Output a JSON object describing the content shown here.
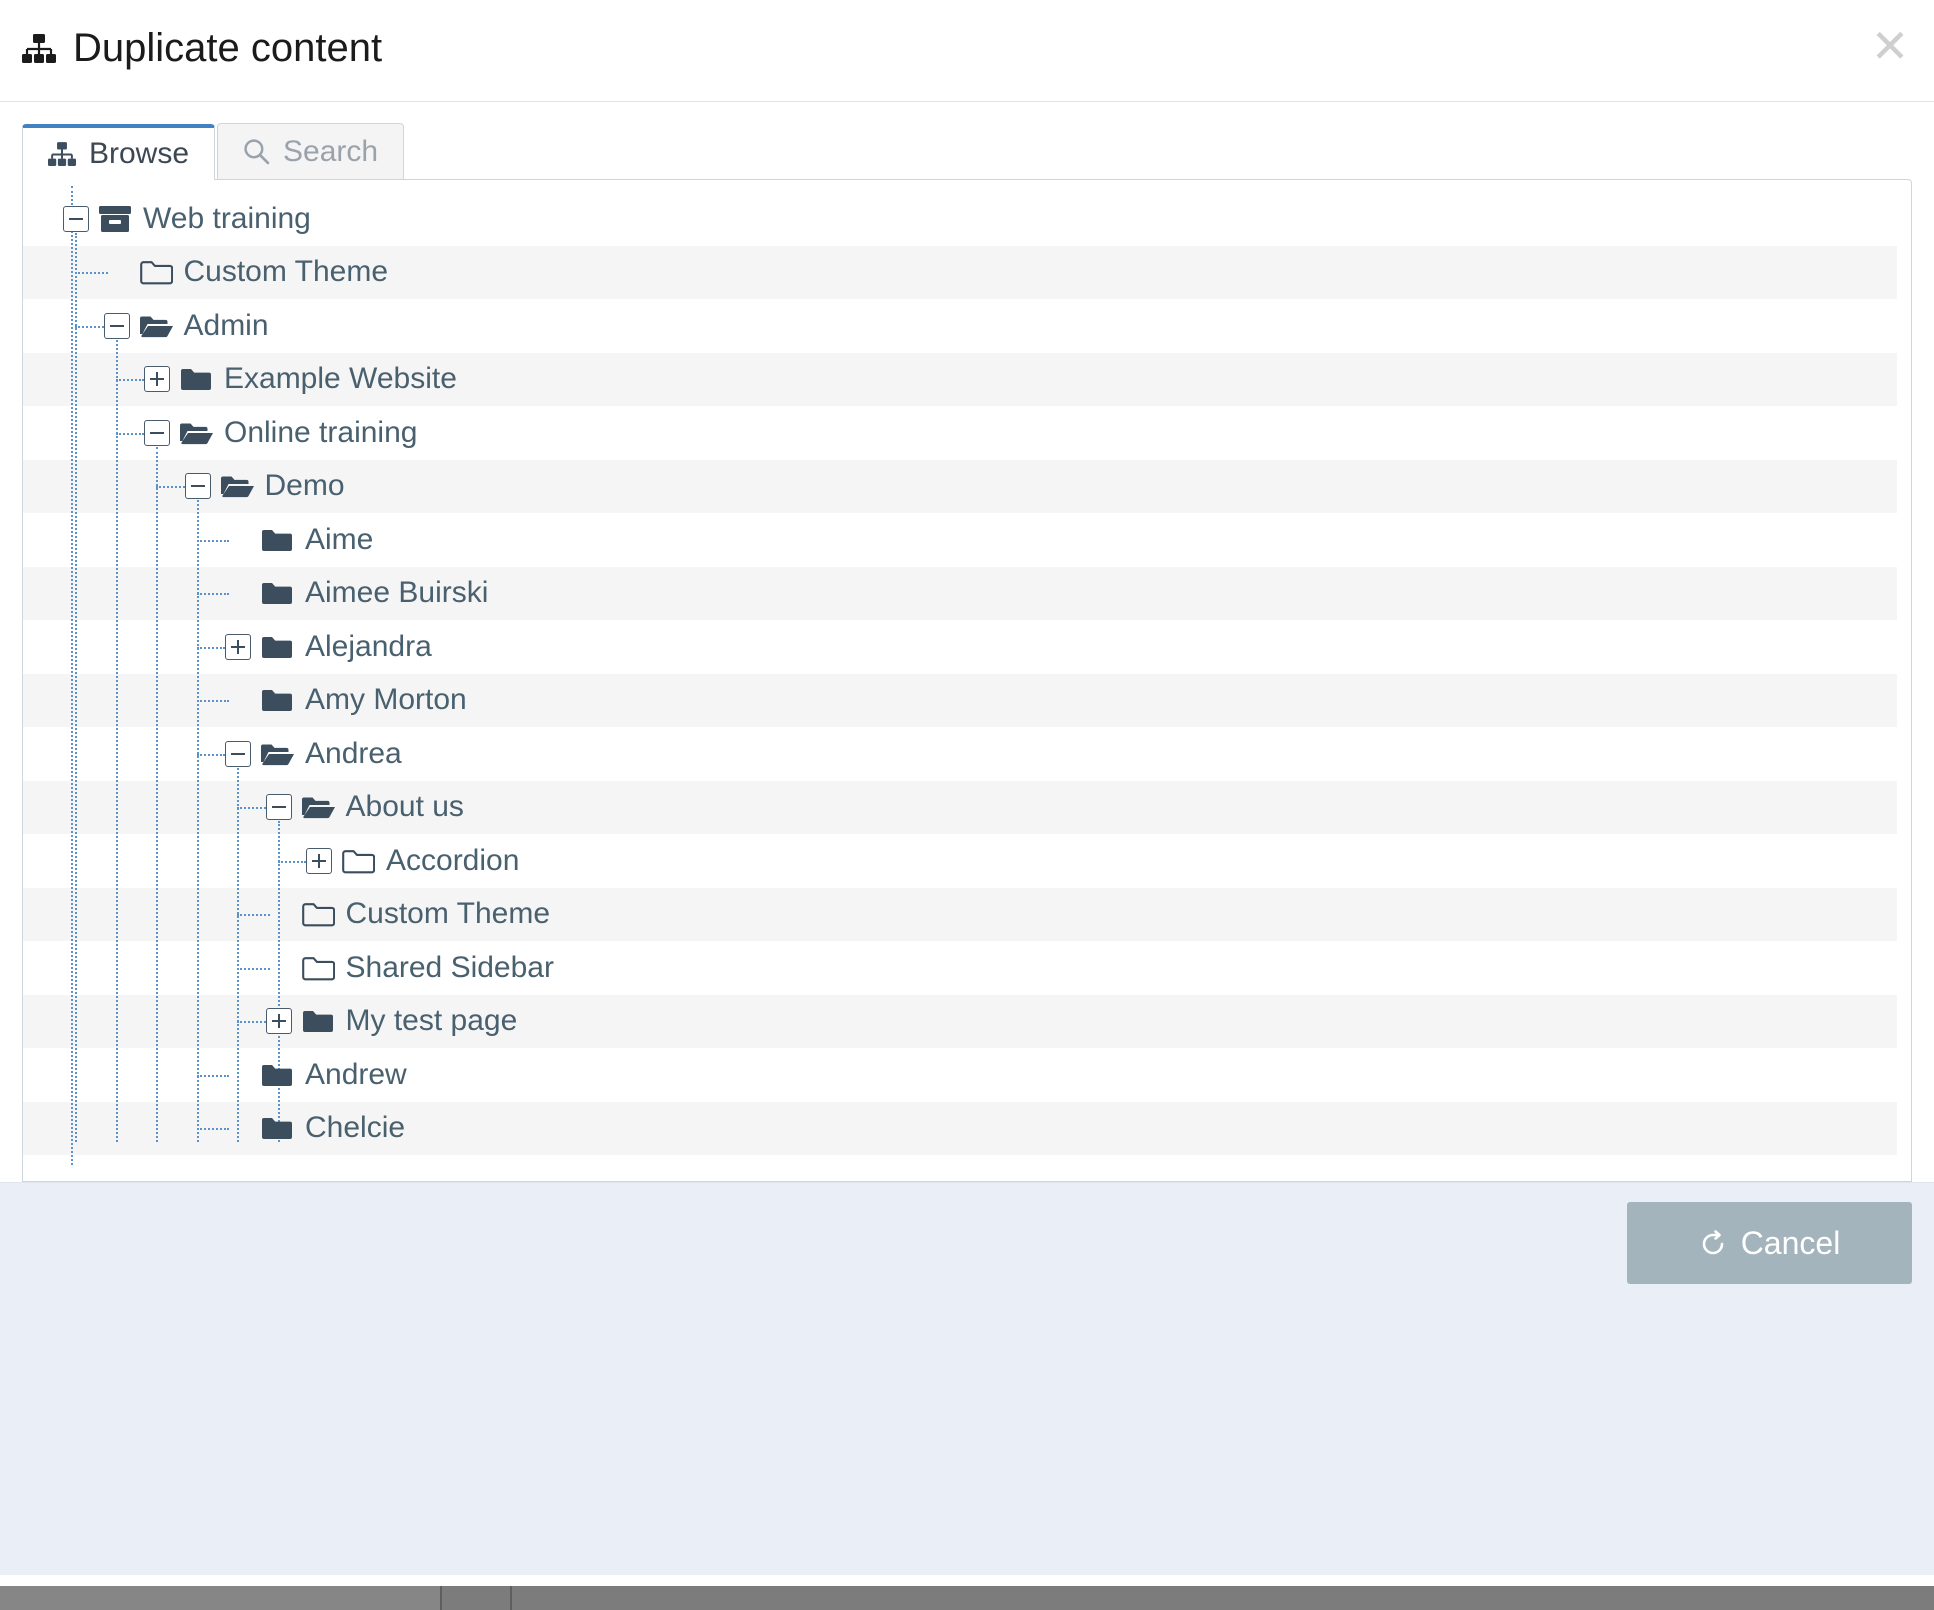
{
  "header": {
    "title": "Duplicate content",
    "icon": "sitemap-icon",
    "close_label": "✕"
  },
  "tabs": [
    {
      "label": "Browse",
      "icon": "sitemap-icon",
      "active": true
    },
    {
      "label": "Search",
      "icon": "search-icon",
      "active": false
    }
  ],
  "tree": {
    "nodes": [
      {
        "label": "Web training",
        "depth": 0,
        "expander": "minus",
        "icon": "archive-icon"
      },
      {
        "label": "Custom Theme",
        "depth": 1,
        "expander": "none",
        "icon": "folder-outline-icon"
      },
      {
        "label": "Admin",
        "depth": 1,
        "expander": "minus",
        "icon": "folder-open-icon"
      },
      {
        "label": "Example Website",
        "depth": 2,
        "expander": "plus",
        "icon": "folder-closed-icon"
      },
      {
        "label": "Online training",
        "depth": 2,
        "expander": "minus",
        "icon": "folder-open-icon"
      },
      {
        "label": "Demo",
        "depth": 3,
        "expander": "minus",
        "icon": "folder-open-icon"
      },
      {
        "label": "Aime",
        "depth": 4,
        "expander": "none",
        "icon": "folder-closed-icon"
      },
      {
        "label": "Aimee Buirski",
        "depth": 4,
        "expander": "none",
        "icon": "folder-closed-icon"
      },
      {
        "label": "Alejandra",
        "depth": 4,
        "expander": "plus",
        "icon": "folder-closed-icon"
      },
      {
        "label": "Amy Morton",
        "depth": 4,
        "expander": "none",
        "icon": "folder-closed-icon"
      },
      {
        "label": "Andrea",
        "depth": 4,
        "expander": "minus",
        "icon": "folder-open-icon"
      },
      {
        "label": "About us",
        "depth": 5,
        "expander": "minus",
        "icon": "folder-open-icon"
      },
      {
        "label": "Accordion",
        "depth": 6,
        "expander": "plus",
        "icon": "folder-outline-icon"
      },
      {
        "label": "Custom Theme",
        "depth": 5,
        "expander": "none",
        "icon": "folder-outline-icon"
      },
      {
        "label": "Shared Sidebar",
        "depth": 5,
        "expander": "none",
        "icon": "folder-outline-icon"
      },
      {
        "label": "My test page",
        "depth": 5,
        "expander": "plus",
        "icon": "folder-closed-icon"
      },
      {
        "label": "Andrew",
        "depth": 4,
        "expander": "none",
        "icon": "folder-closed-icon"
      },
      {
        "label": "Chelcie",
        "depth": 4,
        "expander": "none",
        "icon": "folder-closed-icon"
      }
    ]
  },
  "footer": {
    "cancel_label": "Cancel",
    "cancel_icon": "undo-icon"
  },
  "colors": {
    "accent": "#4282c3",
    "node_text": "#49606f",
    "guide_line": "#5b93c9",
    "row_stripe": "#f5f5f5",
    "footer_bg": "#eaeef6",
    "cancel_bg": "#a4b4bd"
  }
}
